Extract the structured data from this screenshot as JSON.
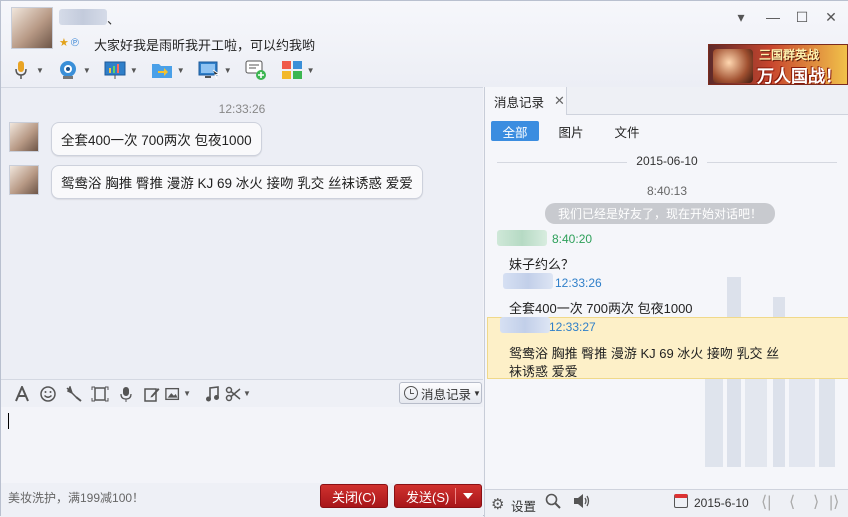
{
  "header": {
    "name_suffix": "、",
    "signature": "大家好我是雨昕我开工啦，可以约我哟",
    "status_star": "★",
    "status_q": "℗",
    "window_controls": [
      "▾",
      "—",
      "☐",
      "✕"
    ],
    "banner": {
      "line1": "三国群英战",
      "line2": "万人国战！"
    }
  },
  "chat": {
    "time": "12:33:26",
    "messages": [
      {
        "text": "全套400一次 700两次 包夜1000"
      },
      {
        "text": "鸳鸯浴 胸推  臀推  漫游 KJ  69  冰火 接吻  乳交  丝袜诱惑  爱爱"
      }
    ]
  },
  "input": {
    "history_label": "消息记录",
    "ad_text": "美妆洗护，满199减100！",
    "close_label": "关闭(C)",
    "send_label": "发送(S)"
  },
  "history": {
    "tab_label": "消息记录",
    "tab_close": "✕",
    "filters": [
      "全部",
      "图片",
      "文件"
    ],
    "date": "2015-06-10",
    "first_time": "8:40:13",
    "system_notice": "我们已经是好友了，现在开始对话吧！",
    "entries": [
      {
        "time": "8:40:20",
        "text": "妹子约么？",
        "color": "#2ea05a"
      },
      {
        "time": "12:33:26",
        "text": "全套400一次 700两次 包夜1000",
        "color": "#2f7fc9"
      },
      {
        "time": "12:33:27",
        "text_line1": "鸳鸯浴 胸推  臀推  漫游 KJ  69  冰火 接吻  乳交  丝",
        "text_line2": "袜诱惑  爱爱",
        "color": "#2f7fc9"
      }
    ],
    "settings_label": "设置",
    "date_field": "2015-6-10",
    "nav": [
      "⟨|",
      "⟨",
      "⟩",
      "|⟩"
    ]
  },
  "colors": {
    "accent_blue": "#3b8de0",
    "send_red": "#c0282a",
    "highlight": "#fdf0c8"
  }
}
